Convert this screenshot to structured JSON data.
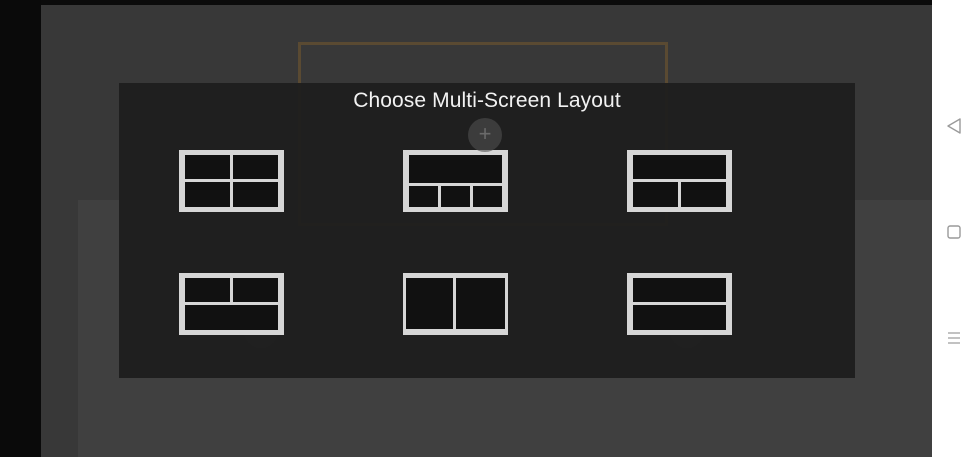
{
  "dialog": {
    "title": "Choose Multi-Screen Layout",
    "layouts": [
      "grid-2x2",
      "top-large-bottom-three",
      "top-large-bottom-two",
      "top-two-bottom-large",
      "side-by-side",
      "top-bottom"
    ]
  },
  "background": {
    "add_glyph": "+"
  },
  "colors": {
    "screen_background": "#3b3b3b",
    "dialog_background": "#1d1d1d",
    "layout_frame": "#d6d6d6",
    "layout_cell": "#111111",
    "frame_accent": "#5a4a32"
  },
  "navigation": {
    "back_icon": "back-triangle-icon",
    "home_icon": "home-square-icon",
    "menu_icon": "menu-lines-icon"
  }
}
